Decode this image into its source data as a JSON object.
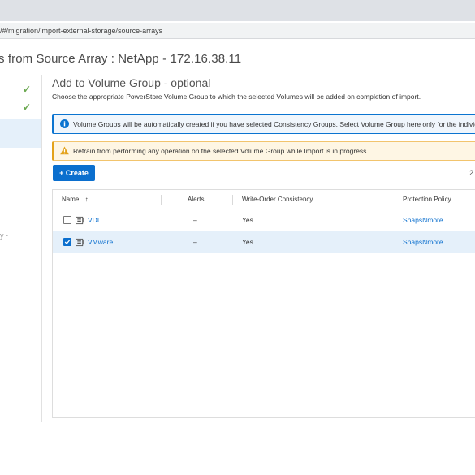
{
  "browser": {
    "url": "/#/migration/import-external-storage/source-arrays"
  },
  "page": {
    "title": "s from Source Array : NetApp - 172.16.38.11"
  },
  "left_panel": {
    "truncated_text": "y -"
  },
  "section": {
    "title": "Add to Volume Group - optional",
    "description": "Choose the appropriate PowerStore Volume Group to which the selected Volumes will be added on completion of import."
  },
  "banners": {
    "info": "Volume Groups will be automatically created if you have selected Consistency Groups. Select Volume Group here only for the individu",
    "warning": "Refrain from performing any operation on the selected Volume Group while Import is in progress."
  },
  "toolbar": {
    "create_label": "+ Create",
    "count": "2"
  },
  "table": {
    "columns": [
      "Name",
      "Alerts",
      "Write-Order Consistency",
      "Protection Policy"
    ],
    "sort_indicator": "↑",
    "rows": [
      {
        "name": "VDI",
        "alerts": "–",
        "write_order": "Yes",
        "policy": "SnapsNmore",
        "selected": false
      },
      {
        "name": "VMware",
        "alerts": "–",
        "write_order": "Yes",
        "policy": "SnapsNmore",
        "selected": true
      }
    ]
  },
  "colors": {
    "accent": "#0b6fce",
    "selected_row": "#e5f0fa",
    "success": "#6aa84f",
    "warning": "#e3a21a"
  }
}
